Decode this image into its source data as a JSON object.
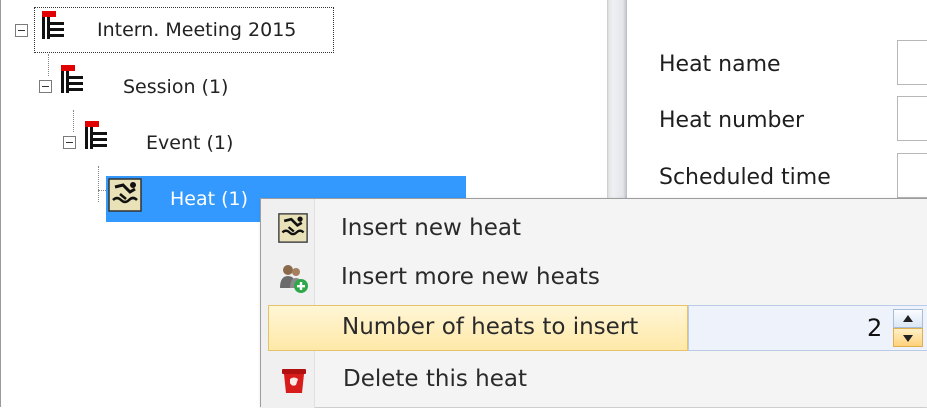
{
  "tree": {
    "nodes": [
      {
        "label": "Intern. Meeting 2015",
        "icon": "hierarchy-icon"
      },
      {
        "label": "Session (1)",
        "icon": "hierarchy-icon"
      },
      {
        "label": "Event (1)",
        "icon": "hierarchy-icon"
      },
      {
        "label": "Heat (1)",
        "icon": "swimmer-icon",
        "selected": true
      }
    ]
  },
  "form": {
    "labels": [
      "Heat name",
      "Heat number",
      "Scheduled time"
    ]
  },
  "context_menu": {
    "items": [
      {
        "label": "Insert new heat",
        "icon": "swimmer-icon"
      },
      {
        "label": "Insert more new heats",
        "icon": "add-people-icon"
      },
      {
        "label": "Number of heats to insert",
        "value": "2"
      },
      {
        "label": "Delete this heat",
        "icon": "trash-icon"
      }
    ]
  },
  "colors": {
    "selection": "#3399ff",
    "menu_highlight": "#ffe9a8",
    "flag_red": "#e00000"
  }
}
